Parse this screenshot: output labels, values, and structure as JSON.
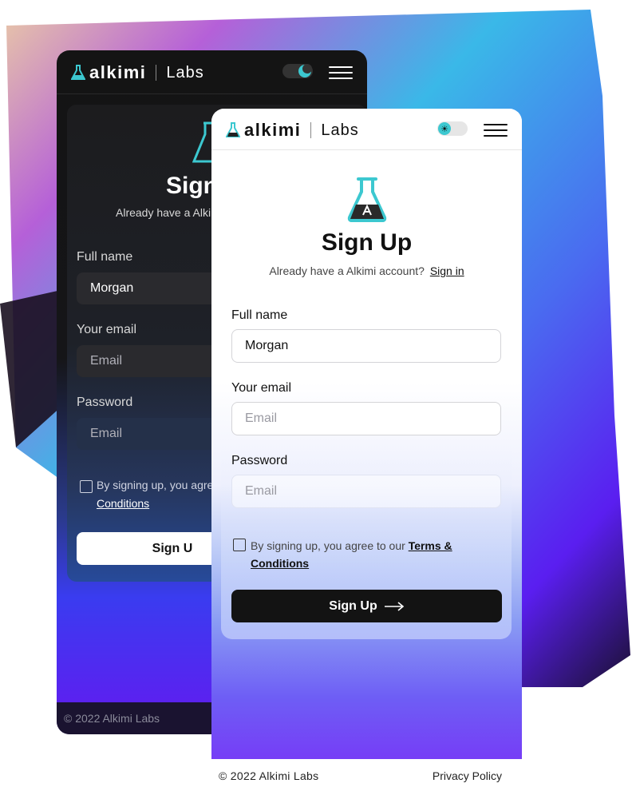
{
  "brand": {
    "name": "alkimi",
    "sub": "Labs"
  },
  "dark": {
    "title": "Sign",
    "subtitle": "Already have a Alki",
    "full_name_label": "Full name",
    "full_name_value": "Morgan",
    "email_label": "Your email",
    "email_placeholder": "Email",
    "password_label": "Password",
    "password_placeholder": "Email",
    "terms_text": "By signing up, you agre",
    "terms_link": "Conditions",
    "button": "Sign U",
    "copyright": "© 2022 Alkimi Labs"
  },
  "light": {
    "title": "Sign Up",
    "subtitle": "Already have a Alkimi account?",
    "signin_link": "Sign in",
    "full_name_label": "Full name",
    "full_name_value": "Morgan",
    "email_label": "Your email",
    "email_placeholder": "Email",
    "password_label": "Password",
    "password_placeholder": "Email",
    "terms_text": "By signing up, you agree to our",
    "terms_link_1": "Terms &",
    "terms_link_2": "Conditions",
    "button": "Sign Up",
    "copyright": "© 2022 Alkimi Labs",
    "privacy": "Privacy Policy"
  },
  "colors": {
    "accent": "#3cc8d0",
    "dark_bg": "#141414",
    "button_dark": "#131313"
  }
}
